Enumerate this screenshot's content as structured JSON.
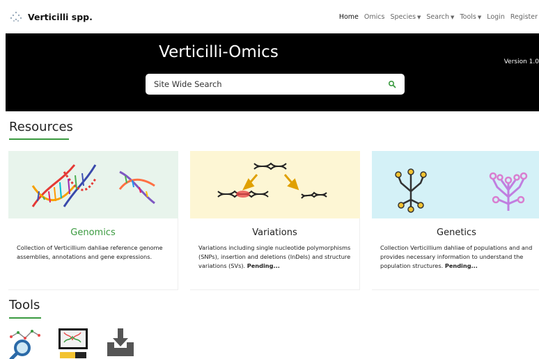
{
  "navbar": {
    "brand": "Verticilli spp.",
    "items": [
      {
        "label": "Home",
        "active": true,
        "dropdown": false
      },
      {
        "label": "Omics",
        "active": false,
        "dropdown": false
      },
      {
        "label": "Species",
        "active": false,
        "dropdown": true
      },
      {
        "label": "Search",
        "active": false,
        "dropdown": true
      },
      {
        "label": "Tools",
        "active": false,
        "dropdown": true
      },
      {
        "label": "Login",
        "active": false,
        "dropdown": false
      },
      {
        "label": "Register",
        "active": false,
        "dropdown": false
      }
    ]
  },
  "hero": {
    "title": "Verticilli-Omics",
    "version": "Version 1.0",
    "search_placeholder": "Site Wide Search"
  },
  "resources": {
    "heading": "Resources",
    "cards": [
      {
        "title": "Genomics",
        "description": "Collection of Verticillium dahliae reference genome assemblies, annotations and gene expressions.",
        "pending": ""
      },
      {
        "title": "Variations",
        "description": "Variations including single nucleotide polymorphisms (SNPs), insertion and deletions (InDels) and structure variations (SVs).",
        "pending": "Pending..."
      },
      {
        "title": "Genetics",
        "description": "Collection Verticillium dahliae of populations and and provides necessary information to understand the population structures.",
        "pending": "Pending..."
      }
    ]
  },
  "tools": {
    "heading": "Tools",
    "items": [
      "search-tool-icon",
      "browser-tool-icon",
      "download-tool-icon"
    ]
  },
  "colors": {
    "accent_green": "#3a9a3f",
    "hero_bg": "#000000",
    "genomics_bg": "#e8f4ec",
    "variations_bg": "#fdf6d4",
    "genetics_bg": "#d4f1f7"
  }
}
